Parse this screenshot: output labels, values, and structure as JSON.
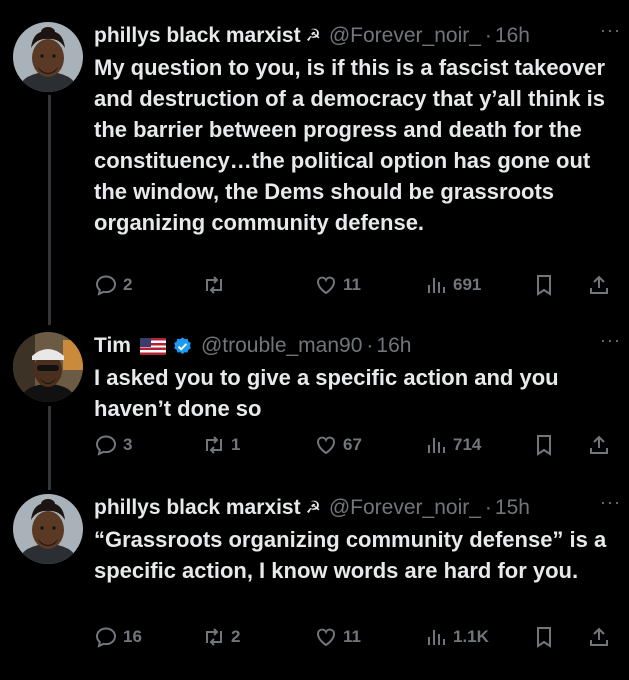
{
  "tweets": [
    {
      "name": "phillys black marxist",
      "symbol": "☭",
      "handle": "@Forever_noir_",
      "time": "16h",
      "text": "My question to you, is if this is a fascist takeover and destruction of a democracy that y’all think is the barrier between progress and death for the constituency…the political option has gone out the window, the Dems should be grassroots organizing community defense.",
      "replies": "2",
      "retweets": "",
      "likes": "11",
      "views": "691"
    },
    {
      "name": "Tim",
      "flag": "us-flag",
      "verified": true,
      "handle": "@trouble_man90",
      "time": "16h",
      "text": "I asked you to give a specific action and you haven’t done so",
      "replies": "3",
      "retweets": "1",
      "likes": "67",
      "views": "714"
    },
    {
      "name": "phillys black marxist",
      "symbol": "☭",
      "handle": "@Forever_noir_",
      "time": "15h",
      "text": "“Grassroots organizing community defense” is a specific action, I know words are hard for you.",
      "replies": "16",
      "retweets": "2",
      "likes": "11",
      "views": "1.1K"
    }
  ],
  "separator": "·",
  "more_glyph": "···",
  "colors": {
    "background": "#000000",
    "text": "#e7e9ea",
    "muted": "#71767b",
    "verified": "#1d9bf0",
    "thread_line": "#333639"
  }
}
